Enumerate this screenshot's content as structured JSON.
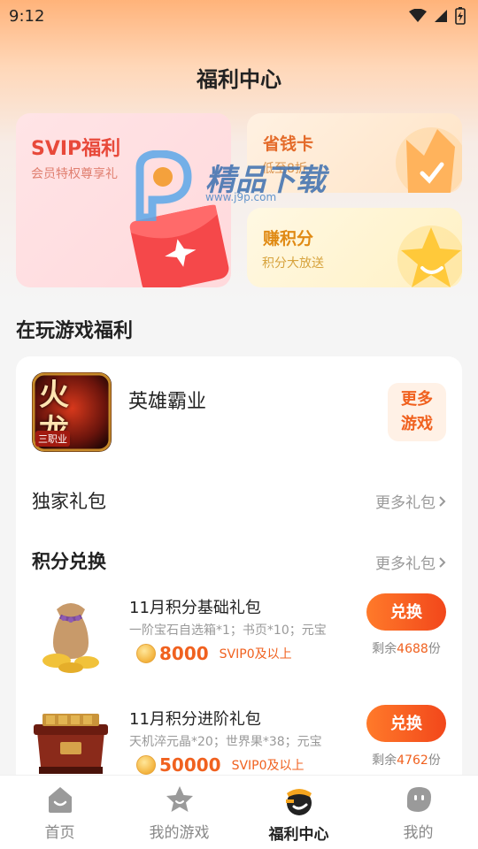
{
  "status_bar": {
    "time": "9:12"
  },
  "header": {
    "title": "福利中心"
  },
  "cards": {
    "svip": {
      "title": "SVIP福利",
      "subtitle": "会员特权尊享礼"
    },
    "save": {
      "title": "省钱卡",
      "subtitle": "低至8折"
    },
    "earn": {
      "title": "赚积分",
      "subtitle": "积分大放送"
    }
  },
  "watermark": {
    "text": "精品下载",
    "url": "www.j9p.com"
  },
  "section": {
    "title": "在玩游戏福利"
  },
  "game": {
    "name": "英雄霸业",
    "more_games_label": "更多\n游戏",
    "icon_text": "火龙",
    "icon_badge": "三职业"
  },
  "exclusive": {
    "title": "独家礼包",
    "more_label": "更多礼包"
  },
  "exchange": {
    "title": "积分兑换",
    "more_label": "更多礼包",
    "items": [
      {
        "title": "11月积分基础礼包",
        "desc": "一阶宝石自选箱*1；书页*10；元宝",
        "price": "8000",
        "level": "SVIP0及以上",
        "button": "兑换",
        "remain_prefix": "剩余",
        "remain_count": "4688",
        "remain_suffix": "份"
      },
      {
        "title": "11月积分进阶礼包",
        "desc": "天机淬元晶*20；世界果*38；元宝",
        "price": "50000",
        "level": "SVIP0及以上",
        "button": "兑换",
        "remain_prefix": "剩余",
        "remain_count": "4762",
        "remain_suffix": "份"
      }
    ]
  },
  "tabs": [
    {
      "label": "首页",
      "icon": "home-face-icon"
    },
    {
      "label": "我的游戏",
      "icon": "star-icon"
    },
    {
      "label": "福利中心",
      "icon": "welfare-mascot-icon",
      "active": true
    },
    {
      "label": "我的",
      "icon": "profile-face-icon"
    }
  ],
  "colors": {
    "accent": "#f0611f",
    "svip_red": "#e8493a"
  }
}
